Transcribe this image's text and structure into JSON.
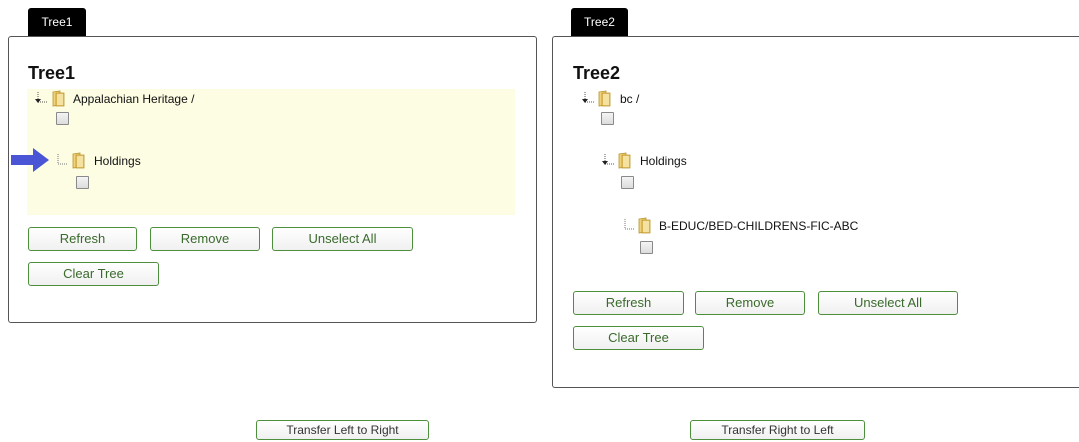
{
  "tree1": {
    "tab_label": "Tree1",
    "title": "Tree1",
    "nodes": [
      {
        "label": "Appalachian Heritage /"
      },
      {
        "label": "Holdings"
      }
    ],
    "buttons": {
      "refresh": "Refresh",
      "remove": "Remove",
      "unselect_all": "Unselect All",
      "clear_tree": "Clear Tree"
    },
    "highlight_color": "#fdfde4"
  },
  "tree2": {
    "tab_label": "Tree2",
    "title": "Tree2",
    "nodes": [
      {
        "label": "bc /"
      },
      {
        "label": "Holdings"
      },
      {
        "label": "B-EDUC/BED-CHILDRENS-FIC-ABC"
      }
    ],
    "buttons": {
      "refresh": "Refresh",
      "remove": "Remove",
      "unselect_all": "Unselect All",
      "clear_tree": "Clear Tree"
    }
  },
  "transfer": {
    "left_to_right": "Transfer Left to Right",
    "right_to_left": "Transfer Right to Left"
  },
  "colors": {
    "button_border": "#4d8f3c",
    "button_text": "#3a6a2c",
    "arrow": "#4a55d6",
    "folder": "#e8c66a"
  }
}
